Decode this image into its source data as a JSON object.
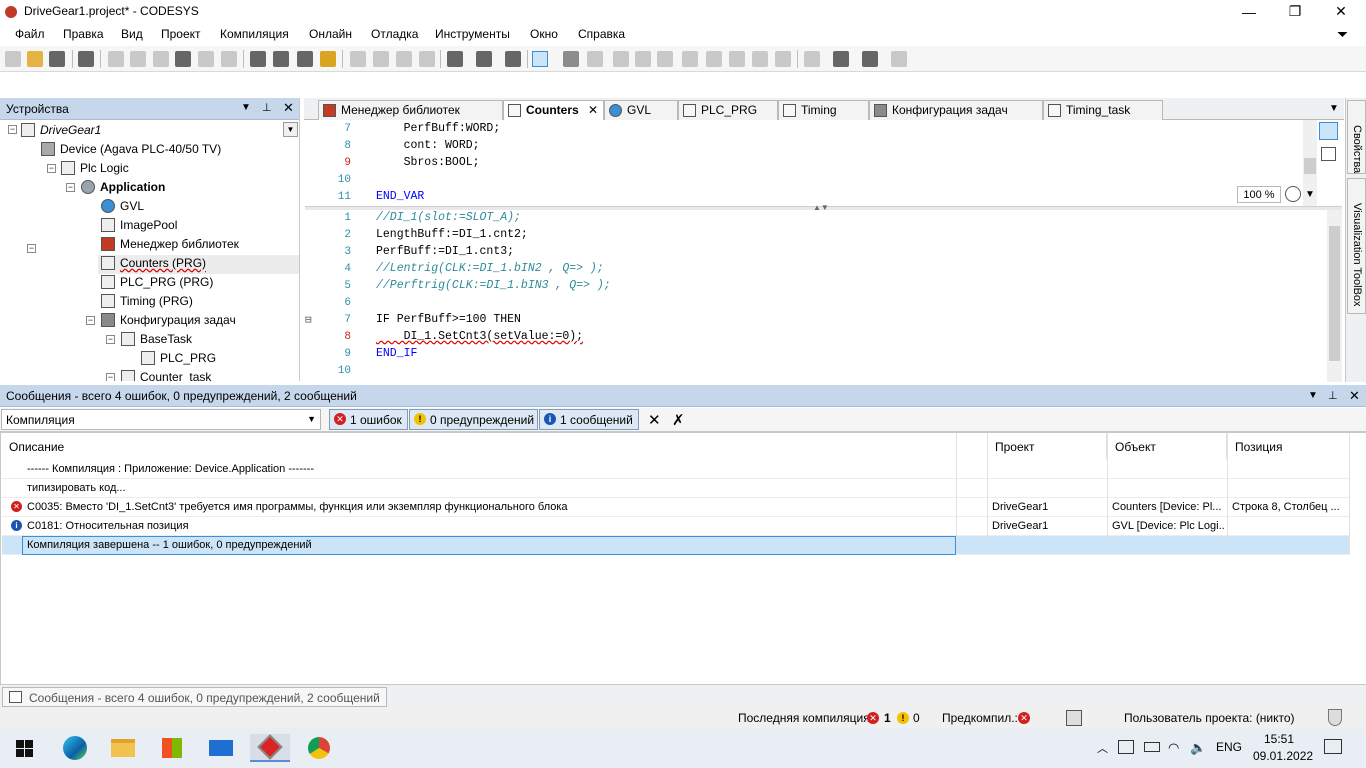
{
  "window": {
    "title": "DriveGear1.project* - CODESYS",
    "min": "—",
    "max": "❐",
    "close": "✕"
  },
  "menu": [
    "Файл",
    "Правка",
    "Вид",
    "Проект",
    "Компиляция",
    "Онлайн",
    "Отладка",
    "Инструменты",
    "Окно",
    "Справка"
  ],
  "devices": {
    "title": "Устройства",
    "tree": [
      {
        "label": "DriveGear1",
        "italic": true
      },
      {
        "label": "Device (Agava PLC-40/50 TV)"
      },
      {
        "label": "Plc Logic"
      },
      {
        "label": "Application",
        "bold": true
      },
      {
        "label": "GVL"
      },
      {
        "label": "ImagePool"
      },
      {
        "label": "Менеджер библиотек"
      },
      {
        "label": "Counters (PRG)",
        "underline": true
      },
      {
        "label": "PLC_PRG (PRG)"
      },
      {
        "label": "Timing (PRG)"
      },
      {
        "label": "Конфигурация задач"
      },
      {
        "label": "BaseTask"
      },
      {
        "label": "PLC_PRG"
      },
      {
        "label": "Counter_task"
      }
    ]
  },
  "tabs": [
    "Менеджер библиотек",
    "Counters",
    "GVL",
    "PLC_PRG",
    "Timing",
    "Конфигурация задач",
    "Timing_task"
  ],
  "tab_close": "✕",
  "editor": {
    "decl_lines": [
      {
        "n": "7",
        "text": "    PerfBuff:WORD;"
      },
      {
        "n": "8",
        "text": "    cont: WORD;"
      },
      {
        "n": "9",
        "text": "    Sbros:BOOL;",
        "red": true
      },
      {
        "n": "10",
        "text": ""
      },
      {
        "n": "11",
        "text": "END_VAR"
      }
    ],
    "zoom": "100 %",
    "code_lines": [
      {
        "n": "1",
        "text": "//DI_1(slot:=SLOT_A);"
      },
      {
        "n": "2",
        "text": "LengthBuff:=DI_1.cnt2;"
      },
      {
        "n": "3",
        "text": "PerfBuff:=DI_1.cnt3;"
      },
      {
        "n": "4",
        "text": "//Lentrig(CLK:=DI_1.bIN2 , Q=> );"
      },
      {
        "n": "5",
        "text": "//Perftrig(CLK:=DI_1.bIN3 , Q=> );"
      },
      {
        "n": "6",
        "text": ""
      },
      {
        "n": "7",
        "text": "IF PerfBuff>=100 THEN"
      },
      {
        "n": "8",
        "text": "    DI_1.SetCnt3(setValue:=0);",
        "red": true
      },
      {
        "n": "9",
        "text": "END_IF"
      },
      {
        "n": "10",
        "text": ""
      }
    ],
    "fold_marker": "⊟"
  },
  "side_tabs": [
    "Свойства",
    "Visualization ToolBox"
  ],
  "messages": {
    "title": "Сообщения - всего 4 ошибок, 0 предупреждений, 2 сообщений",
    "filter": "Компиляция",
    "err_btn": "1 ошибок",
    "warn_btn": "0 предупреждений",
    "info_btn": "1 сообщений",
    "columns": [
      "Описание",
      "Проект",
      "Объект",
      "Позиция"
    ],
    "rows": [
      {
        "desc": "------ Компиляция : Приложение: Device.Application -------",
        "project": "",
        "object": "",
        "pos": "",
        "icon": ""
      },
      {
        "desc": "типизировать код...",
        "project": "",
        "object": "",
        "pos": "",
        "icon": ""
      },
      {
        "desc": "C0035:  Вместо 'DI_1.SetCnt3' требуется имя программы, функция или экземпляр функционального блока",
        "project": "DriveGear1",
        "object": "Counters [Device: Pl...",
        "pos": "Строка 8, Столбец ...",
        "icon": "err"
      },
      {
        "desc": "C0181:  Относительная позиция",
        "project": "DriveGear1",
        "object": "GVL [Device: Plc Logi...",
        "pos": "",
        "icon": "info"
      },
      {
        "desc": "Компиляция завершена -- 1 ошибок, 0 предупреждений",
        "project": "",
        "object": "",
        "pos": "",
        "icon": "",
        "selected": true
      }
    ]
  },
  "bottom_tab": "Сообщения - всего 4 ошибок, 0 предупреждений, 2 сообщений",
  "status": {
    "last_compile_label": "Последняя компиляция:",
    "errors": "1",
    "warnings": "0",
    "precompile_label": "Предкомпил.:",
    "user": "Пользователь проекта: (никто)"
  },
  "taskbar": {
    "lang": "ENG",
    "time": "15:51",
    "date": "09.01.2022"
  }
}
